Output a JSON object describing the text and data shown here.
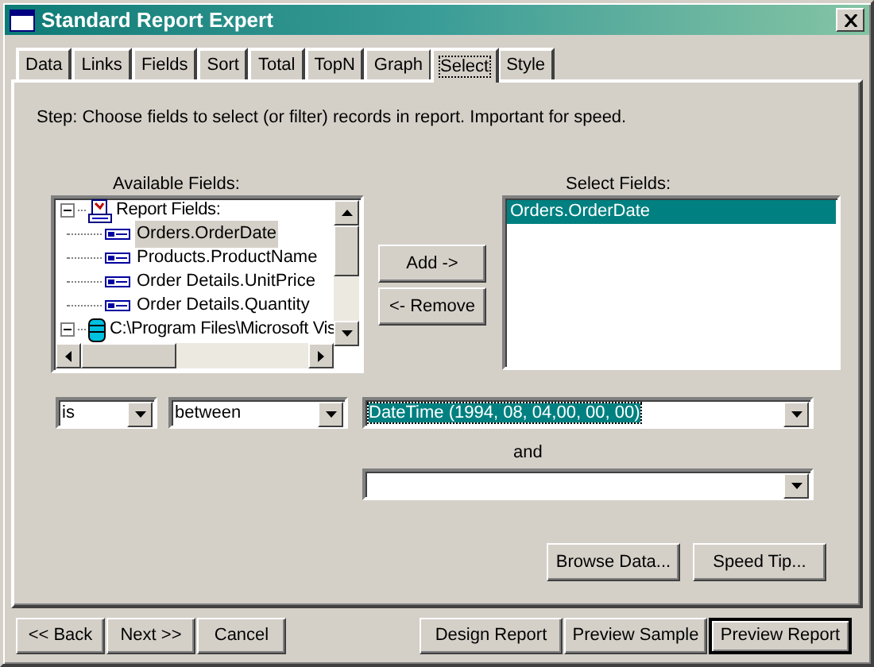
{
  "window": {
    "title": "Standard Report Expert"
  },
  "tabs": [
    {
      "label": "Data",
      "selected": false
    },
    {
      "label": "Links",
      "selected": false
    },
    {
      "label": "Fields",
      "selected": false
    },
    {
      "label": "Sort",
      "selected": false
    },
    {
      "label": "Total",
      "selected": false
    },
    {
      "label": "TopN",
      "selected": false
    },
    {
      "label": "Graph",
      "selected": false
    },
    {
      "label": "Select",
      "selected": true
    },
    {
      "label": "Style",
      "selected": false
    }
  ],
  "step_text": "Step:  Choose fields to select (or filter) records in report.  Important for speed.",
  "available_fields": {
    "label": "Available Fields:",
    "tree": [
      {
        "label": "Report Fields:",
        "kind": "report",
        "expanded": true,
        "children": [
          {
            "label": "Orders.OrderDate",
            "selected": true
          },
          {
            "label": "Products.ProductName",
            "selected": false
          },
          {
            "label": "Order Details.UnitPrice",
            "selected": false
          },
          {
            "label": "Order Details.Quantity",
            "selected": false
          }
        ]
      },
      {
        "label": "C:\\Program Files\\Microsoft Vis",
        "kind": "database",
        "expanded": true
      }
    ]
  },
  "add_button": "Add ->",
  "remove_button": "<- Remove",
  "select_fields": {
    "label": "Select Fields:",
    "items": [
      {
        "label": "Orders.OrderDate",
        "selected": true
      }
    ]
  },
  "filter": {
    "operator": "is",
    "comparison": "between",
    "from": {
      "value": "DateTime (1994, 08, 04,00, 00, 00)",
      "highlighted": true
    },
    "and_label": "and"
  },
  "browse_button": "Browse Data...",
  "speed_tip_button": "Speed Tip...",
  "footer_buttons": [
    {
      "label": "<< Back",
      "default": false
    },
    {
      "label": "Next >>",
      "default": false
    },
    {
      "label": "Cancel",
      "default": false
    },
    {
      "label": "Design Report",
      "default": false
    },
    {
      "label": "Preview Sample",
      "default": false
    },
    {
      "label": "Preview Report",
      "default": true
    }
  ]
}
